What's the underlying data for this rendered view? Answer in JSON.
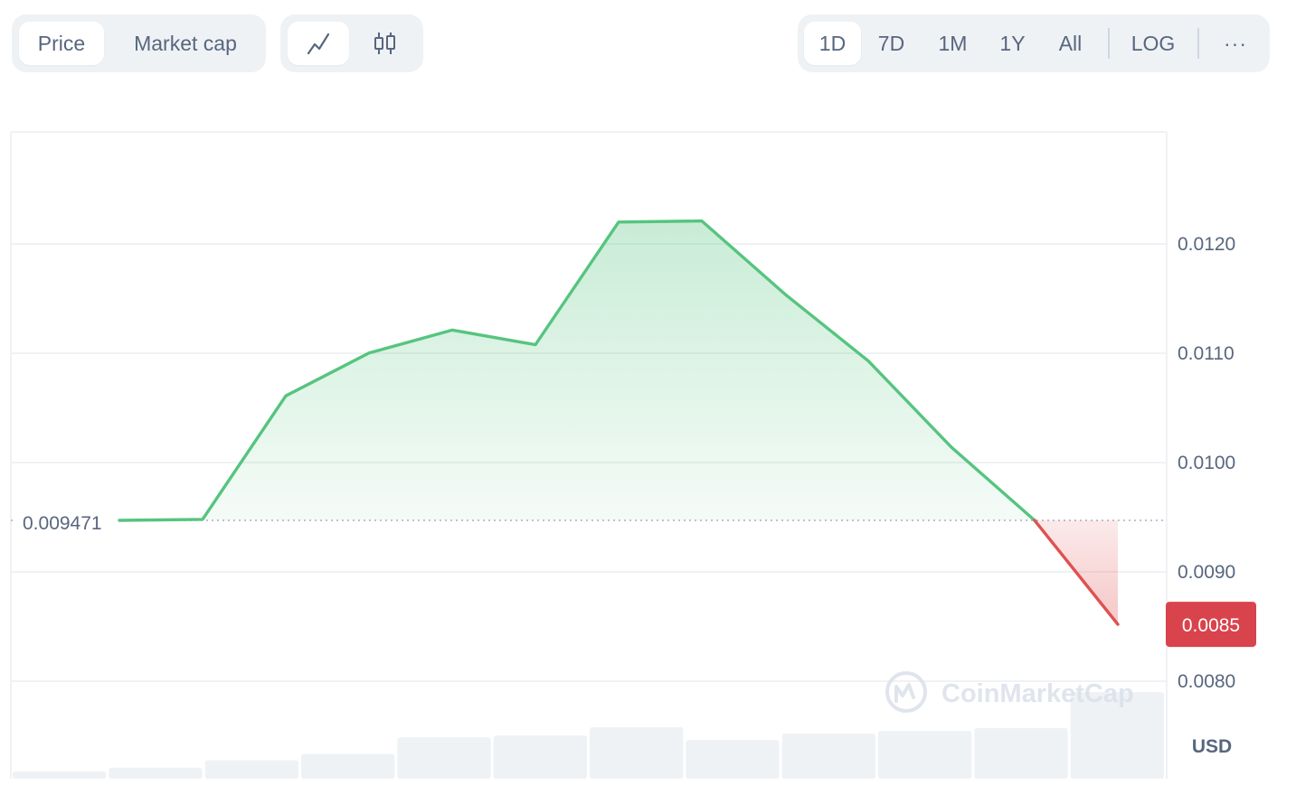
{
  "toolbar": {
    "metric_tabs": [
      {
        "label": "Price",
        "active": true
      },
      {
        "label": "Market cap",
        "active": false
      }
    ],
    "chart_type_buttons": [
      {
        "icon": "line-chart-icon",
        "active": true
      },
      {
        "icon": "candlestick-icon",
        "active": false
      }
    ],
    "range_tabs": [
      {
        "label": "1D",
        "active": true
      },
      {
        "label": "7D",
        "active": false
      },
      {
        "label": "1M",
        "active": false
      },
      {
        "label": "1Y",
        "active": false
      },
      {
        "label": "All",
        "active": false
      }
    ],
    "log_label": "LOG",
    "more_label": "···"
  },
  "watermark": "CoinMarketCap",
  "currency_label": "USD",
  "baseline_label": "0.009471",
  "current_price_label": "0.0085",
  "colors": {
    "up": "#56c47f",
    "down": "#e05050",
    "price_badge": "#d9434c",
    "grid": "#eff2f5",
    "volume": "#eff2f5"
  },
  "chart_data": {
    "type": "area",
    "series": [
      {
        "values": [
          0.009471,
          0.00948,
          0.01061,
          0.011002,
          0.011212,
          0.011078,
          0.0122,
          0.01221,
          0.01154,
          0.01093,
          0.01014,
          0.009471,
          0.00852
        ]
      }
    ],
    "baseline": 0.009471,
    "y_ticks": [
      "0.0120",
      "0.0110",
      "0.0100",
      "0.0090",
      "0.0080"
    ],
    "ylim": [
      0.008,
      0.012
    ],
    "volume": [
      0.08,
      0.12,
      0.2,
      0.27,
      0.45,
      0.47,
      0.56,
      0.42,
      0.49,
      0.52,
      0.55,
      0.94
    ],
    "grid": true
  }
}
